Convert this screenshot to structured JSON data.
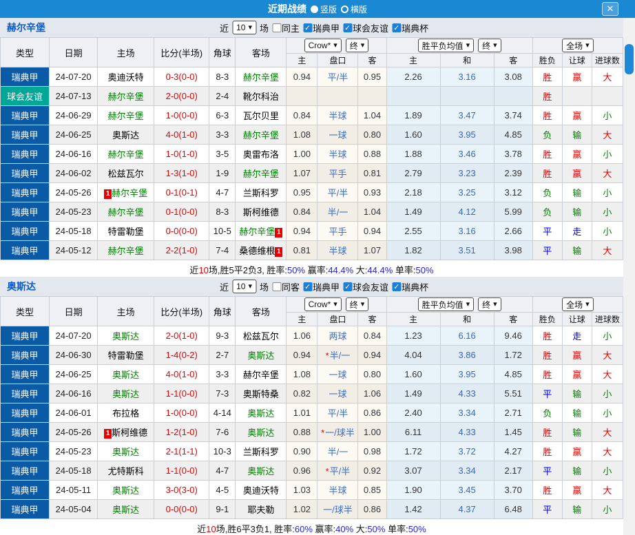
{
  "titlebar": {
    "title": "近期战绩",
    "orientation_options": [
      {
        "label": "竖版",
        "selected": true
      },
      {
        "label": "横版",
        "selected": false
      }
    ],
    "close_icon": "✕"
  },
  "colors": {
    "titlebar_blue": "#1b88d3",
    "league_type_blue": "#0b5aa6",
    "friendly_teal": "#00a796",
    "win_red": "#e60000",
    "lose_green": "#008000",
    "draw_blue": "#0000e0",
    "scrollbar_thumb": "#1e88d8"
  },
  "sections": [
    {
      "team": "赫尔辛堡",
      "controls": {
        "near": "近",
        "count": "10",
        "games": "场",
        "same": "同主",
        "same_checked": false,
        "leagues": [
          {
            "label": "瑞典甲",
            "checked": true
          },
          {
            "label": "球会友谊",
            "checked": true
          },
          {
            "label": "瑞典杯",
            "checked": true
          }
        ]
      },
      "header": {
        "cols": [
          "类型",
          "日期",
          "主场",
          "比分(半场)",
          "角球",
          "客场"
        ],
        "company": "Crow*",
        "company_final": "终",
        "avg": "胜平负均值",
        "avg_final": "终",
        "scope": "全场",
        "sub": [
          "主",
          "盘口",
          "客",
          "主",
          "和",
          "客",
          "胜负",
          "让球",
          "进球数"
        ]
      },
      "rows": [
        {
          "league": "瑞典甲",
          "friendly": false,
          "date": "24-07-20",
          "home": {
            "name": "奥迪沃特",
            "self": false,
            "badge": ""
          },
          "score": "0-3(0-0)",
          "corner": "8-3",
          "away": {
            "name": "赫尔辛堡",
            "self": true,
            "badge": ""
          },
          "odds": [
            "0.94",
            "平/半",
            "0.95"
          ],
          "star": false,
          "avg": [
            "2.26",
            "3.16",
            "3.08"
          ],
          "res": [
            [
              "胜",
              "r"
            ],
            [
              "赢",
              "r"
            ],
            [
              "大",
              "r"
            ]
          ]
        },
        {
          "league": "球会友谊",
          "friendly": true,
          "date": "24-07-13",
          "home": {
            "name": "赫尔辛堡",
            "self": true,
            "badge": ""
          },
          "score": "2-0(0-0)",
          "corner": "2-4",
          "away": {
            "name": "靴尔科治",
            "self": false,
            "badge": ""
          },
          "odds": [
            "",
            "",
            ""
          ],
          "star": false,
          "avg": [
            "",
            "",
            ""
          ],
          "res": [
            [
              "胜",
              "r"
            ],
            [
              "",
              ""
            ],
            [
              "",
              ""
            ]
          ]
        },
        {
          "league": "瑞典甲",
          "friendly": false,
          "date": "24-06-29",
          "home": {
            "name": "赫尔辛堡",
            "self": true,
            "badge": ""
          },
          "score": "1-0(0-0)",
          "corner": "6-3",
          "away": {
            "name": "瓦尔贝里",
            "self": false,
            "badge": ""
          },
          "odds": [
            "0.84",
            "半球",
            "1.04"
          ],
          "star": false,
          "avg": [
            "1.89",
            "3.47",
            "3.74"
          ],
          "res": [
            [
              "胜",
              "r"
            ],
            [
              "赢",
              "r"
            ],
            [
              "小",
              "g"
            ]
          ]
        },
        {
          "league": "瑞典甲",
          "friendly": false,
          "date": "24-06-25",
          "home": {
            "name": "奥斯达",
            "self": false,
            "badge": ""
          },
          "score": "4-0(1-0)",
          "corner": "3-3",
          "away": {
            "name": "赫尔辛堡",
            "self": true,
            "badge": ""
          },
          "odds": [
            "1.08",
            "一球",
            "0.80"
          ],
          "star": false,
          "avg": [
            "1.60",
            "3.95",
            "4.85"
          ],
          "res": [
            [
              "负",
              "g"
            ],
            [
              "输",
              "g"
            ],
            [
              "大",
              "r"
            ]
          ]
        },
        {
          "league": "瑞典甲",
          "friendly": false,
          "date": "24-06-16",
          "home": {
            "name": "赫尔辛堡",
            "self": true,
            "badge": ""
          },
          "score": "1-0(1-0)",
          "corner": "3-5",
          "away": {
            "name": "奥雷布洛",
            "self": false,
            "badge": ""
          },
          "odds": [
            "1.00",
            "半球",
            "0.88"
          ],
          "star": false,
          "avg": [
            "1.88",
            "3.46",
            "3.78"
          ],
          "res": [
            [
              "胜",
              "r"
            ],
            [
              "赢",
              "r"
            ],
            [
              "小",
              "g"
            ]
          ]
        },
        {
          "league": "瑞典甲",
          "friendly": false,
          "date": "24-06-02",
          "home": {
            "name": "松兹瓦尔",
            "self": false,
            "badge": ""
          },
          "score": "1-3(1-0)",
          "corner": "1-9",
          "away": {
            "name": "赫尔辛堡",
            "self": true,
            "badge": ""
          },
          "odds": [
            "1.07",
            "平手",
            "0.81"
          ],
          "star": false,
          "avg": [
            "2.79",
            "3.23",
            "2.39"
          ],
          "res": [
            [
              "胜",
              "r"
            ],
            [
              "赢",
              "r"
            ],
            [
              "大",
              "r"
            ]
          ]
        },
        {
          "league": "瑞典甲",
          "friendly": false,
          "date": "24-05-26",
          "home": {
            "name": "赫尔辛堡",
            "self": true,
            "badge": "1"
          },
          "score": "0-1(0-1)",
          "corner": "4-7",
          "away": {
            "name": "兰斯科罗",
            "self": false,
            "badge": ""
          },
          "odds": [
            "0.95",
            "平/半",
            "0.93"
          ],
          "star": false,
          "avg": [
            "2.18",
            "3.25",
            "3.12"
          ],
          "res": [
            [
              "负",
              "g"
            ],
            [
              "输",
              "g"
            ],
            [
              "小",
              "g"
            ]
          ]
        },
        {
          "league": "瑞典甲",
          "friendly": false,
          "date": "24-05-23",
          "home": {
            "name": "赫尔辛堡",
            "self": true,
            "badge": ""
          },
          "score": "0-1(0-0)",
          "corner": "8-3",
          "away": {
            "name": "斯柯维德",
            "self": false,
            "badge": ""
          },
          "odds": [
            "0.84",
            "半/一",
            "1.04"
          ],
          "star": false,
          "avg": [
            "1.49",
            "4.12",
            "5.99"
          ],
          "res": [
            [
              "负",
              "g"
            ],
            [
              "输",
              "g"
            ],
            [
              "小",
              "g"
            ]
          ]
        },
        {
          "league": "瑞典甲",
          "friendly": false,
          "date": "24-05-18",
          "home": {
            "name": "特雷勒堡",
            "self": false,
            "badge": ""
          },
          "score": "0-0(0-0)",
          "corner": "10-5",
          "away": {
            "name": "赫尔辛堡",
            "self": true,
            "badge": "1"
          },
          "odds": [
            "0.94",
            "平手",
            "0.94"
          ],
          "star": false,
          "avg": [
            "2.55",
            "3.16",
            "2.66"
          ],
          "res": [
            [
              "平",
              "b"
            ],
            [
              "走",
              "b"
            ],
            [
              "小",
              "g"
            ]
          ]
        },
        {
          "league": "瑞典甲",
          "friendly": false,
          "date": "24-05-12",
          "home": {
            "name": "赫尔辛堡",
            "self": true,
            "badge": ""
          },
          "score": "2-2(1-0)",
          "corner": "7-4",
          "away": {
            "name": "桑德维根",
            "self": false,
            "badge": "1"
          },
          "odds": [
            "0.81",
            "半球",
            "1.07"
          ],
          "star": false,
          "avg": [
            "1.82",
            "3.51",
            "3.98"
          ],
          "res": [
            [
              "平",
              "b"
            ],
            [
              "输",
              "g"
            ],
            [
              "大",
              "r"
            ]
          ]
        }
      ],
      "summary": [
        [
          "近",
          "k"
        ],
        [
          "10",
          "r"
        ],
        [
          "场,胜5平2负3, 胜率:",
          "k"
        ],
        [
          "50%",
          "b"
        ],
        [
          " 赢率:",
          "k"
        ],
        [
          "44.4%",
          "b"
        ],
        [
          " 大:",
          "k"
        ],
        [
          "44.4%",
          "b"
        ],
        [
          " 单率:",
          "k"
        ],
        [
          "50%",
          "b"
        ]
      ]
    },
    {
      "team": "奥斯达",
      "controls": {
        "near": "近",
        "count": "10",
        "games": "场",
        "same": "同客",
        "same_checked": false,
        "leagues": [
          {
            "label": "瑞典甲",
            "checked": true
          },
          {
            "label": "球会友谊",
            "checked": true
          },
          {
            "label": "瑞典杯",
            "checked": true
          }
        ]
      },
      "header": {
        "cols": [
          "类型",
          "日期",
          "主场",
          "比分(半场)",
          "角球",
          "客场"
        ],
        "company": "Crow*",
        "company_final": "终",
        "avg": "胜平负均值",
        "avg_final": "终",
        "scope": "全场",
        "sub": [
          "主",
          "盘口",
          "客",
          "主",
          "和",
          "客",
          "胜负",
          "让球",
          "进球数"
        ]
      },
      "rows": [
        {
          "league": "瑞典甲",
          "friendly": false,
          "date": "24-07-20",
          "home": {
            "name": "奥斯达",
            "self": true,
            "badge": ""
          },
          "score": "2-0(1-0)",
          "corner": "9-3",
          "away": {
            "name": "松兹瓦尔",
            "self": false,
            "badge": ""
          },
          "odds": [
            "1.06",
            "两球",
            "0.84"
          ],
          "star": false,
          "avg": [
            "1.23",
            "6.16",
            "9.46"
          ],
          "res": [
            [
              "胜",
              "r"
            ],
            [
              "走",
              "b"
            ],
            [
              "小",
              "g"
            ]
          ]
        },
        {
          "league": "瑞典甲",
          "friendly": false,
          "date": "24-06-30",
          "home": {
            "name": "特雷勒堡",
            "self": false,
            "badge": ""
          },
          "score": "1-4(0-2)",
          "corner": "2-7",
          "away": {
            "name": "奥斯达",
            "self": true,
            "badge": ""
          },
          "odds": [
            "0.94",
            "半/一",
            "0.94"
          ],
          "star": true,
          "avg": [
            "4.04",
            "3.86",
            "1.72"
          ],
          "res": [
            [
              "胜",
              "r"
            ],
            [
              "赢",
              "r"
            ],
            [
              "大",
              "r"
            ]
          ]
        },
        {
          "league": "瑞典甲",
          "friendly": false,
          "date": "24-06-25",
          "home": {
            "name": "奥斯达",
            "self": true,
            "badge": ""
          },
          "score": "4-0(1-0)",
          "corner": "3-3",
          "away": {
            "name": "赫尔辛堡",
            "self": false,
            "badge": ""
          },
          "odds": [
            "1.08",
            "一球",
            "0.80"
          ],
          "star": false,
          "avg": [
            "1.60",
            "3.95",
            "4.85"
          ],
          "res": [
            [
              "胜",
              "r"
            ],
            [
              "赢",
              "r"
            ],
            [
              "大",
              "r"
            ]
          ]
        },
        {
          "league": "瑞典甲",
          "friendly": false,
          "date": "24-06-16",
          "home": {
            "name": "奥斯达",
            "self": true,
            "badge": ""
          },
          "score": "1-1(0-0)",
          "corner": "7-3",
          "away": {
            "name": "奥斯特桑",
            "self": false,
            "badge": ""
          },
          "odds": [
            "0.82",
            "一球",
            "1.06"
          ],
          "star": false,
          "avg": [
            "1.49",
            "4.33",
            "5.51"
          ],
          "res": [
            [
              "平",
              "b"
            ],
            [
              "输",
              "g"
            ],
            [
              "小",
              "g"
            ]
          ]
        },
        {
          "league": "瑞典甲",
          "friendly": false,
          "date": "24-06-01",
          "home": {
            "name": "布拉格",
            "self": false,
            "badge": ""
          },
          "score": "1-0(0-0)",
          "corner": "4-14",
          "away": {
            "name": "奥斯达",
            "self": true,
            "badge": ""
          },
          "odds": [
            "1.01",
            "平/半",
            "0.86"
          ],
          "star": false,
          "avg": [
            "2.40",
            "3.34",
            "2.71"
          ],
          "res": [
            [
              "负",
              "g"
            ],
            [
              "输",
              "g"
            ],
            [
              "小",
              "g"
            ]
          ]
        },
        {
          "league": "瑞典甲",
          "friendly": false,
          "date": "24-05-26",
          "home": {
            "name": "斯柯维德",
            "self": false,
            "badge": "1"
          },
          "score": "1-2(1-0)",
          "corner": "7-6",
          "away": {
            "name": "奥斯达",
            "self": true,
            "badge": ""
          },
          "odds": [
            "0.88",
            "一/球半",
            "1.00"
          ],
          "star": true,
          "avg": [
            "6.11",
            "4.33",
            "1.45"
          ],
          "res": [
            [
              "胜",
              "r"
            ],
            [
              "输",
              "g"
            ],
            [
              "大",
              "r"
            ]
          ]
        },
        {
          "league": "瑞典甲",
          "friendly": false,
          "date": "24-05-23",
          "home": {
            "name": "奥斯达",
            "self": true,
            "badge": ""
          },
          "score": "2-1(1-1)",
          "corner": "10-3",
          "away": {
            "name": "兰斯科罗",
            "self": false,
            "badge": ""
          },
          "odds": [
            "0.90",
            "半/一",
            "0.98"
          ],
          "star": false,
          "avg": [
            "1.72",
            "3.72",
            "4.27"
          ],
          "res": [
            [
              "胜",
              "r"
            ],
            [
              "赢",
              "r"
            ],
            [
              "大",
              "r"
            ]
          ]
        },
        {
          "league": "瑞典甲",
          "friendly": false,
          "date": "24-05-18",
          "home": {
            "name": "尤特斯科",
            "self": false,
            "badge": ""
          },
          "score": "1-1(0-0)",
          "corner": "4-7",
          "away": {
            "name": "奥斯达",
            "self": true,
            "badge": ""
          },
          "odds": [
            "0.96",
            "平/半",
            "0.92"
          ],
          "star": true,
          "avg": [
            "3.07",
            "3.34",
            "2.17"
          ],
          "res": [
            [
              "平",
              "b"
            ],
            [
              "输",
              "g"
            ],
            [
              "小",
              "g"
            ]
          ]
        },
        {
          "league": "瑞典甲",
          "friendly": false,
          "date": "24-05-11",
          "home": {
            "name": "奥斯达",
            "self": true,
            "badge": ""
          },
          "score": "3-0(3-0)",
          "corner": "4-5",
          "away": {
            "name": "奥迪沃特",
            "self": false,
            "badge": ""
          },
          "odds": [
            "1.03",
            "半球",
            "0.85"
          ],
          "star": false,
          "avg": [
            "1.90",
            "3.45",
            "3.70"
          ],
          "res": [
            [
              "胜",
              "r"
            ],
            [
              "赢",
              "r"
            ],
            [
              "大",
              "r"
            ]
          ]
        },
        {
          "league": "瑞典甲",
          "friendly": false,
          "date": "24-05-04",
          "home": {
            "name": "奥斯达",
            "self": true,
            "badge": ""
          },
          "score": "0-0(0-0)",
          "corner": "9-1",
          "away": {
            "name": "耶夫勒",
            "self": false,
            "badge": ""
          },
          "odds": [
            "1.02",
            "一/球半",
            "0.86"
          ],
          "star": false,
          "avg": [
            "1.42",
            "4.37",
            "6.48"
          ],
          "res": [
            [
              "平",
              "b"
            ],
            [
              "输",
              "g"
            ],
            [
              "小",
              "g"
            ]
          ]
        }
      ],
      "summary": [
        [
          "近",
          "k"
        ],
        [
          "10",
          "r"
        ],
        [
          "场,胜6平3负1, 胜率:",
          "k"
        ],
        [
          "60%",
          "b"
        ],
        [
          " 赢率:",
          "k"
        ],
        [
          "40%",
          "b"
        ],
        [
          " 大:",
          "k"
        ],
        [
          "50%",
          "b"
        ],
        [
          " 单率:",
          "k"
        ],
        [
          "50%",
          "b"
        ]
      ]
    }
  ]
}
